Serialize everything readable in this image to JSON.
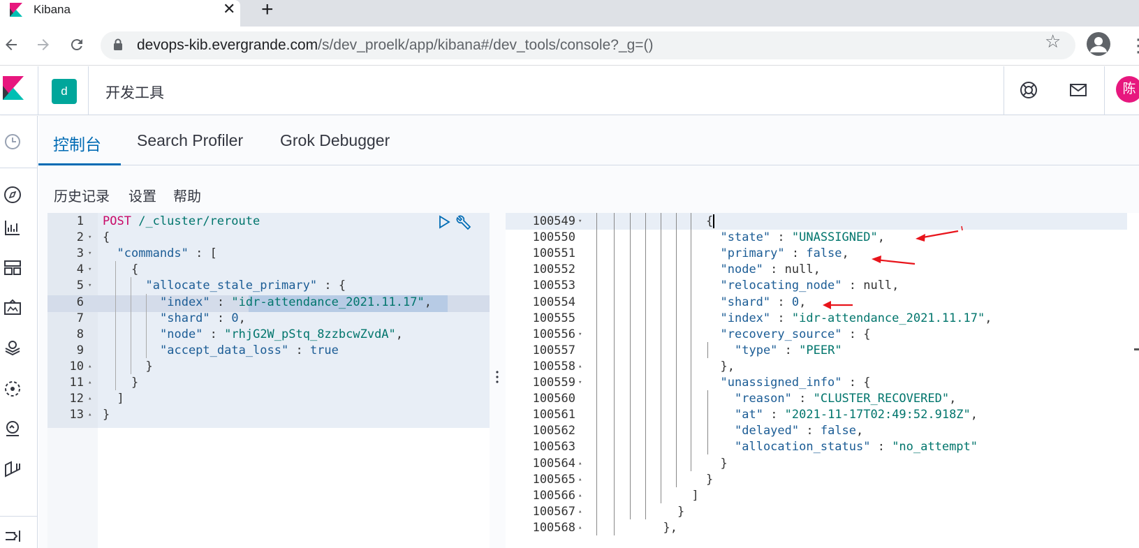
{
  "browser": {
    "tab_title": "Kibana",
    "tab_close": "✕",
    "new_tab": "+",
    "url_host": "devops-kib.evergrande.com",
    "url_path": "/s/dev_proelk/app/kibana#/dev_tools/console?_g=()"
  },
  "header": {
    "space_letter": "d",
    "page_title": "开发工具",
    "avatar_letter": "陈"
  },
  "tabs": [
    {
      "label": "控制台",
      "active": true
    },
    {
      "label": "Search Profiler",
      "active": false
    },
    {
      "label": "Grok Debugger",
      "active": false
    }
  ],
  "subnav": {
    "history": "历史记录",
    "settings": "设置",
    "help": "帮助"
  },
  "editor": {
    "line_numbers": [
      "1",
      "2",
      "3",
      "4",
      "5",
      "6",
      "7",
      "8",
      "9",
      "10",
      "11",
      "12",
      "13"
    ],
    "lines": [
      {
        "indent": 0,
        "parts": [
          [
            "k-method",
            "POST"
          ],
          [
            "k-p",
            " "
          ],
          [
            "k-url",
            "/_cluster/reroute"
          ]
        ]
      },
      {
        "indent": 0,
        "parts": [
          [
            "k-p",
            "{"
          ]
        ]
      },
      {
        "indent": 2,
        "parts": [
          [
            "k-key",
            "\"commands\""
          ],
          [
            "k-p",
            " : ["
          ]
        ]
      },
      {
        "indent": 4,
        "parts": [
          [
            "k-p",
            "{"
          ]
        ]
      },
      {
        "indent": 6,
        "parts": [
          [
            "k-key",
            "\"allocate_stale_primary\""
          ],
          [
            "k-p",
            " : {"
          ]
        ]
      },
      {
        "indent": 8,
        "parts": [
          [
            "k-key",
            "\"index\""
          ],
          [
            "k-p",
            " : "
          ],
          [
            "k-str",
            "\"idr-attendance_2021.11.17\""
          ],
          [
            "k-p",
            ","
          ]
        ]
      },
      {
        "indent": 8,
        "parts": [
          [
            "k-key",
            "\"shard\""
          ],
          [
            "k-p",
            " : "
          ],
          [
            "k-num",
            "0"
          ],
          [
            "k-p",
            ","
          ]
        ]
      },
      {
        "indent": 8,
        "parts": [
          [
            "k-key",
            "\"node\""
          ],
          [
            "k-p",
            " : "
          ],
          [
            "k-str",
            "\"rhjG2W_pStq_8zzbcwZvdA\""
          ],
          [
            "k-p",
            ","
          ]
        ]
      },
      {
        "indent": 8,
        "parts": [
          [
            "k-key",
            "\"accept_data_loss\""
          ],
          [
            "k-p",
            " : "
          ],
          [
            "k-bool",
            "true"
          ]
        ]
      },
      {
        "indent": 6,
        "parts": [
          [
            "k-p",
            "}"
          ]
        ]
      },
      {
        "indent": 4,
        "parts": [
          [
            "k-p",
            "}"
          ]
        ]
      },
      {
        "indent": 2,
        "parts": [
          [
            "k-p",
            "]"
          ]
        ]
      },
      {
        "indent": 0,
        "parts": [
          [
            "k-p",
            "}"
          ]
        ]
      }
    ]
  },
  "output": {
    "line_numbers": [
      "100549",
      "100550",
      "100551",
      "100552",
      "100553",
      "100554",
      "100555",
      "100556",
      "100557",
      "100558",
      "100559",
      "100560",
      "100561",
      "100562",
      "100563",
      "100564",
      "100565",
      "100566",
      "100567",
      "100568"
    ],
    "lines": [
      {
        "indent": 0,
        "parts": [
          [
            "k-p",
            "{"
          ]
        ]
      },
      {
        "indent": 2,
        "parts": [
          [
            "k-key",
            "\"state\""
          ],
          [
            "k-p",
            " : "
          ],
          [
            "k-str",
            "\"UNASSIGNED\""
          ],
          [
            "k-p",
            ","
          ]
        ]
      },
      {
        "indent": 2,
        "parts": [
          [
            "k-key",
            "\"primary\""
          ],
          [
            "k-p",
            " : "
          ],
          [
            "k-bool",
            "false"
          ],
          [
            "k-p",
            ","
          ]
        ]
      },
      {
        "indent": 2,
        "parts": [
          [
            "k-key",
            "\"node\""
          ],
          [
            "k-p",
            " : "
          ],
          [
            "k-null",
            "null"
          ],
          [
            "k-p",
            ","
          ]
        ]
      },
      {
        "indent": 2,
        "parts": [
          [
            "k-key",
            "\"relocating_node\""
          ],
          [
            "k-p",
            " : "
          ],
          [
            "k-null",
            "null"
          ],
          [
            "k-p",
            ","
          ]
        ]
      },
      {
        "indent": 2,
        "parts": [
          [
            "k-key",
            "\"shard\""
          ],
          [
            "k-p",
            " : "
          ],
          [
            "k-num",
            "0"
          ],
          [
            "k-p",
            ","
          ]
        ]
      },
      {
        "indent": 2,
        "parts": [
          [
            "k-key",
            "\"index\""
          ],
          [
            "k-p",
            " : "
          ],
          [
            "k-str",
            "\"idr-attendance_2021.11.17\""
          ],
          [
            "k-p",
            ","
          ]
        ]
      },
      {
        "indent": 2,
        "parts": [
          [
            "k-key",
            "\"recovery_source\""
          ],
          [
            "k-p",
            " : {"
          ]
        ]
      },
      {
        "indent": 4,
        "parts": [
          [
            "k-key",
            "\"type\""
          ],
          [
            "k-p",
            " : "
          ],
          [
            "k-str",
            "\"PEER\""
          ]
        ]
      },
      {
        "indent": 2,
        "parts": [
          [
            "k-p",
            "},"
          ]
        ]
      },
      {
        "indent": 2,
        "parts": [
          [
            "k-key",
            "\"unassigned_info\""
          ],
          [
            "k-p",
            " : {"
          ]
        ]
      },
      {
        "indent": 4,
        "parts": [
          [
            "k-key",
            "\"reason\""
          ],
          [
            "k-p",
            " : "
          ],
          [
            "k-str",
            "\"CLUSTER_RECOVERED\""
          ],
          [
            "k-p",
            ","
          ]
        ]
      },
      {
        "indent": 4,
        "parts": [
          [
            "k-key",
            "\"at\""
          ],
          [
            "k-p",
            " : "
          ],
          [
            "k-str",
            "\"2021-11-17T02:49:52.918Z\""
          ],
          [
            "k-p",
            ","
          ]
        ]
      },
      {
        "indent": 4,
        "parts": [
          [
            "k-key",
            "\"delayed\""
          ],
          [
            "k-p",
            " : "
          ],
          [
            "k-bool",
            "false"
          ],
          [
            "k-p",
            ","
          ]
        ]
      },
      {
        "indent": 4,
        "parts": [
          [
            "k-key",
            "\"allocation_status\""
          ],
          [
            "k-p",
            " : "
          ],
          [
            "k-str",
            "\"no_attempt\""
          ]
        ]
      },
      {
        "indent": 2,
        "parts": [
          [
            "k-p",
            "}"
          ]
        ]
      },
      {
        "indent": 0,
        "parts": [
          [
            "k-p",
            "}"
          ]
        ]
      },
      {
        "indent": -2,
        "parts": [
          [
            "k-p",
            "]"
          ]
        ]
      },
      {
        "indent": -4,
        "parts": [
          [
            "k-p",
            "}"
          ]
        ]
      },
      {
        "indent": -6,
        "parts": [
          [
            "k-p",
            "},"
          ]
        ]
      }
    ]
  },
  "colors": {
    "accent": "#006bb4",
    "space_badge": "#00a69b",
    "avatar": "#e7177e",
    "annotation_arrow": "#e8141b"
  }
}
